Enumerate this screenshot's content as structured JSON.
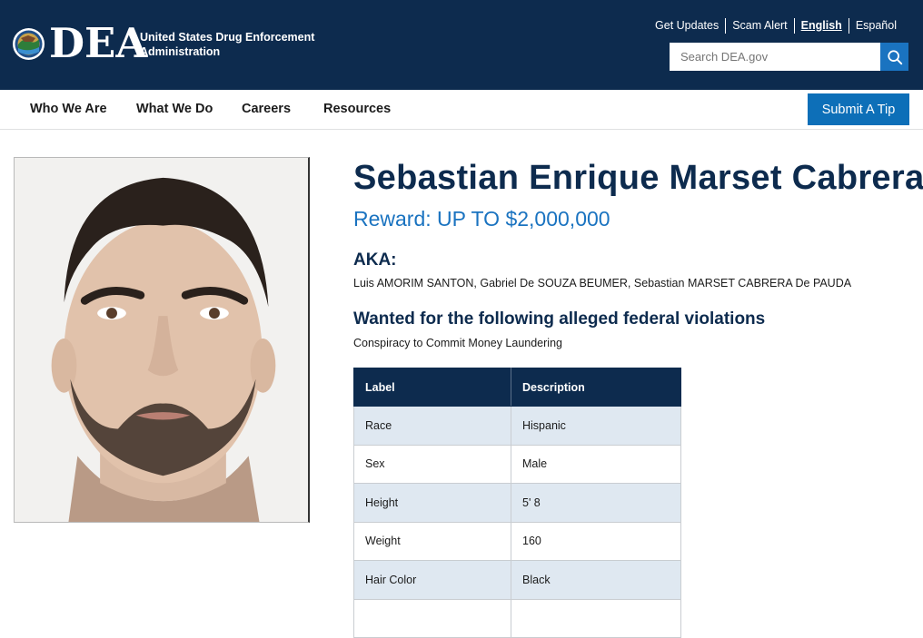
{
  "header": {
    "logo_text": "DEA",
    "agency_name": "United States Drug Enforcement Administration",
    "utility_links": [
      "Get Updates",
      "Scam Alert",
      "English",
      "Español"
    ],
    "active_language": "English",
    "search": {
      "placeholder": "Search DEA.gov",
      "icon": "search-icon"
    }
  },
  "nav": {
    "items": [
      "Who We Are",
      "What We Do",
      "Careers",
      "Resources"
    ],
    "tip_button": "Submit A Tip"
  },
  "profile": {
    "name": "Sebastian Enrique Marset Cabrera",
    "reward": "Reward: UP TO $2,000,000",
    "aka_heading": "AKA:",
    "aka": "Luis AMORIM SANTON, Gabriel De SOUZA BEUMER, Sebastian MARSET CABRERA De PAUDA",
    "violations_heading": "Wanted for the following alleged federal violations",
    "violations": "Conspiracy to Commit Money Laundering"
  },
  "table": {
    "headers": [
      "Label",
      "Description"
    ],
    "rows": [
      [
        "Race",
        "Hispanic"
      ],
      [
        "Sex",
        "Male"
      ],
      [
        "Height",
        "5' 8"
      ],
      [
        "Weight",
        "160"
      ],
      [
        "Hair Color",
        "Black"
      ],
      [
        "",
        ""
      ]
    ]
  },
  "colors": {
    "header_bg": "#0d2b4e",
    "accent": "#1a73c0",
    "button": "#0d6fb8",
    "row_alt": "#dfe8f1"
  }
}
